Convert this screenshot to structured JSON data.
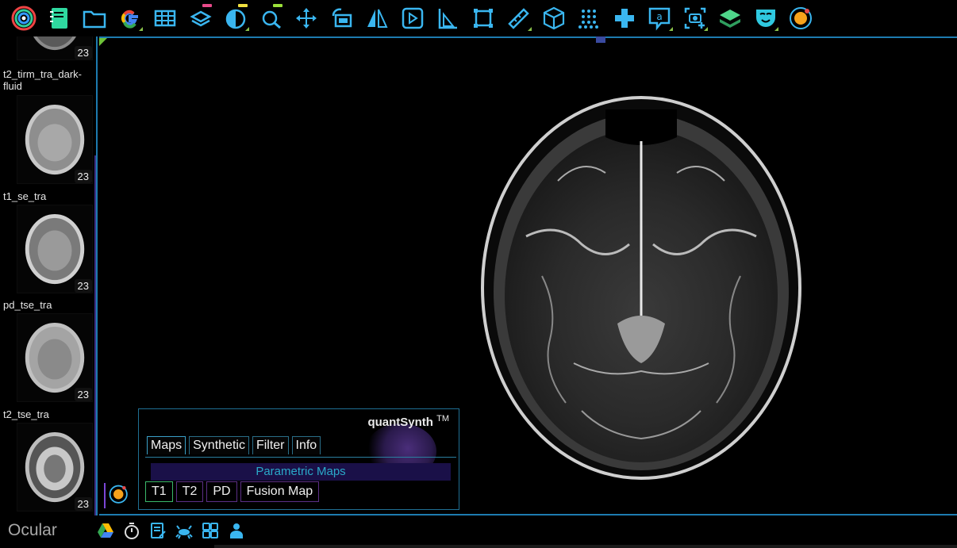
{
  "toolbar": {
    "icons": [
      "ocular-logo-icon",
      "notebook-icon",
      "folder-icon",
      "google-icon",
      "grid-icon",
      "layers-icon",
      "contrast-icon",
      "zoom-icon",
      "move-icon",
      "rotate-icon",
      "flip-icon",
      "play-icon",
      "ruler-icon",
      "crop-icon",
      "measure-icon",
      "cube-icon",
      "dots-icon",
      "cross-icon",
      "annotate-icon",
      "screenshot-icon",
      "layer-stack-icon",
      "mask-icon",
      "ocular-orange-icon"
    ]
  },
  "sidebar": {
    "series": [
      {
        "label": "",
        "count": "23"
      },
      {
        "label": "t2_tirm_tra_dark-fluid",
        "count": "23"
      },
      {
        "label": "t1_se_tra",
        "count": "23"
      },
      {
        "label": "pd_tse_tra",
        "count": "23"
      },
      {
        "label": "t2_tse_tra",
        "count": "23"
      }
    ]
  },
  "quantsynth": {
    "title": "quantSynth",
    "trademark": "TM",
    "tabs": [
      "Maps",
      "Synthetic",
      "Filter",
      "Info"
    ],
    "section_title": "Parametric Maps",
    "map_buttons": [
      "T1",
      "T2",
      "PD",
      "Fusion Map"
    ]
  },
  "bottombar": {
    "brand": "Ocular",
    "icons": [
      "google-drive-icon",
      "stopwatch-icon",
      "notes-icon",
      "crab-icon",
      "calculator-icon",
      "user-icon"
    ]
  },
  "colors": {
    "accent_blue": "#1d7bb0",
    "accent_purple": "#5b2e86",
    "accent_green": "#3ab86a",
    "section_text": "#2aa9c9"
  }
}
